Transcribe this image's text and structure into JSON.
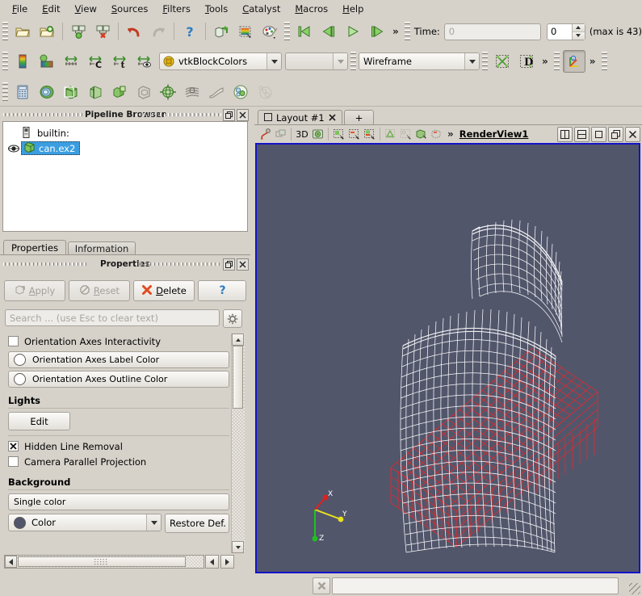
{
  "app": {
    "background_color": "#d6d2ca",
    "render_background_color": "#52566b",
    "accent_blue": "#1414c8"
  },
  "menubar": {
    "items": [
      {
        "label": "File",
        "mnemonic": "F"
      },
      {
        "label": "Edit",
        "mnemonic": "E"
      },
      {
        "label": "View",
        "mnemonic": "V"
      },
      {
        "label": "Sources",
        "mnemonic": "S"
      },
      {
        "label": "Filters",
        "mnemonic": "F"
      },
      {
        "label": "Tools",
        "mnemonic": "T"
      },
      {
        "label": "Catalyst",
        "mnemonic": "C"
      },
      {
        "label": "Macros",
        "mnemonic": "M"
      },
      {
        "label": "Help",
        "mnemonic": "H"
      }
    ]
  },
  "toolbar_main": {
    "buttons": [
      {
        "name": "open-file-icon",
        "tooltip": "Open"
      },
      {
        "name": "recent-files-icon",
        "tooltip": "Recent Files"
      },
      {
        "name": "save-state-icon",
        "tooltip": "Save State"
      },
      {
        "name": "load-state-icon",
        "tooltip": "Load State"
      },
      {
        "name": "undo-icon",
        "tooltip": "Undo"
      },
      {
        "name": "redo-icon",
        "tooltip": "Redo"
      },
      {
        "name": "help-icon",
        "tooltip": "Help"
      },
      {
        "name": "connect-server-icon",
        "tooltip": "Connect"
      },
      {
        "name": "capture-screenshot-icon",
        "tooltip": "Save Screenshot"
      },
      {
        "name": "color-palette-icon",
        "tooltip": "Edit Color Palette"
      }
    ],
    "vcr": [
      {
        "name": "first-frame-icon",
        "tooltip": "First Frame"
      },
      {
        "name": "previous-frame-icon",
        "tooltip": "Previous Frame"
      },
      {
        "name": "play-icon",
        "tooltip": "Play"
      },
      {
        "name": "next-frame-icon",
        "tooltip": "Next Frame"
      }
    ],
    "overflow_label": "»",
    "time_label": "Time:",
    "time_value": "",
    "time_placeholder": "0",
    "frame_value": "0",
    "max_label": "(max is 43)"
  },
  "toolbar_color": {
    "buttons": [
      {
        "name": "color-legend-icon",
        "tooltip": "Toggle Color Legend Visibility"
      },
      {
        "name": "edit-color-map-icon",
        "tooltip": "Edit Color Map"
      },
      {
        "name": "rescale-to-data-range-icon",
        "tooltip": "Rescale to Data Range"
      },
      {
        "name": "rescale-custom-range-icon",
        "tooltip": "Rescale to Custom Data Range"
      },
      {
        "name": "rescale-temporal-range-icon",
        "tooltip": "Rescale to Data Range Over All Timesteps"
      },
      {
        "name": "rescale-visible-range-icon",
        "tooltip": "Rescale to Visible Range"
      }
    ],
    "array_combo_value": "vtkBlockColors",
    "component_combo_value": "",
    "representation_combo_value": "Wireframe",
    "extra_buttons": [
      {
        "name": "show-center-axes-icon",
        "tooltip": "Show Center"
      },
      {
        "name": "data-axes-grid-icon",
        "tooltip": "Data Axes Grid"
      }
    ],
    "overflow_label": "»",
    "pressed_button": {
      "name": "center-axes-visibility-icon",
      "tooltip": "Center Axes Visibility"
    },
    "overflow_label2": "»"
  },
  "toolbar_filters": {
    "buttons": [
      {
        "name": "calculator-filter-icon",
        "tooltip": "Calculator"
      },
      {
        "name": "contour-filter-icon",
        "tooltip": "Contour"
      },
      {
        "name": "clip-filter-icon",
        "tooltip": "Clip"
      },
      {
        "name": "slice-filter-icon",
        "tooltip": "Slice"
      },
      {
        "name": "threshold-filter-icon",
        "tooltip": "Threshold"
      },
      {
        "name": "extract-subset-filter-icon",
        "tooltip": "Extract Subset"
      },
      {
        "name": "glyph-filter-icon",
        "tooltip": "Glyph"
      },
      {
        "name": "stream-tracer-filter-icon",
        "tooltip": "Stream Tracer"
      },
      {
        "name": "warp-filter-icon",
        "tooltip": "Warp By Vector"
      },
      {
        "name": "group-datasets-filter-icon",
        "tooltip": "Group Datasets"
      },
      {
        "name": "extract-level-filter-icon",
        "tooltip": "Extract Level"
      }
    ]
  },
  "pipeline_browser": {
    "title": "Pipeline Browser",
    "float_button": "float-panel-icon",
    "close_button": "close-panel-icon",
    "server": {
      "label": "builtin:",
      "icon": "server-icon"
    },
    "items": [
      {
        "label": "can.ex2",
        "icon": "dataset-icon",
        "selected": true,
        "visible": true,
        "eye_icon": "eye-icon"
      }
    ]
  },
  "properties_panel": {
    "tabs": [
      {
        "label": "Properties",
        "active": true
      },
      {
        "label": "Information",
        "active": false
      }
    ],
    "title": "Properties",
    "float_button": "float-panel-icon",
    "close_button": "close-panel-icon",
    "buttons": [
      {
        "label": "Apply",
        "mnemonic": "A",
        "icon": "apply-icon",
        "enabled": false
      },
      {
        "label": "Reset",
        "mnemonic": "R",
        "icon": "reset-icon",
        "enabled": false
      },
      {
        "label": "Delete",
        "mnemonic": "D",
        "icon": "delete-icon",
        "enabled": true
      },
      {
        "label": "",
        "icon": "help-question-icon",
        "enabled": true
      }
    ],
    "search_placeholder": "Search ... (use Esc to clear text)",
    "search_value": "",
    "gear_button": "gear-icon",
    "rows": [
      {
        "type": "checkbox",
        "label": "Orientation Axes Interactivity",
        "checked": false
      },
      {
        "type": "colorbutton",
        "label": "Orientation Axes Label Color",
        "swatch": "#ffffff"
      },
      {
        "type": "colorbutton",
        "label": "Orientation Axes Outline Color",
        "swatch": "#ffffff"
      },
      {
        "type": "group",
        "label": "Lights"
      },
      {
        "type": "button",
        "label": "Edit"
      },
      {
        "type": "separator"
      },
      {
        "type": "checkbox",
        "label": "Hidden Line Removal",
        "checked": true
      },
      {
        "type": "checkbox",
        "label": "Camera Parallel Projection",
        "checked": false
      },
      {
        "type": "group",
        "label": "Background"
      },
      {
        "type": "combo",
        "label": "Single color"
      },
      {
        "type": "colorcombo",
        "label": "Color",
        "swatch": "#52566b",
        "side_button": "Restore Def."
      }
    ]
  },
  "layout": {
    "tabs": [
      {
        "label": "Layout #1",
        "icon": "layout-icon",
        "close_icon": "close-tab-icon",
        "active": true
      },
      {
        "label": "+",
        "active": false
      }
    ]
  },
  "view_toolbar": {
    "buttons": [
      {
        "name": "interactive-select-icon"
      },
      {
        "name": "interactive-select-points-icon"
      },
      {
        "name": "3d-label",
        "label": "3D"
      },
      {
        "name": "camera-reset-icon"
      },
      {
        "name": "select-cells-icon"
      },
      {
        "name": "select-points-icon"
      },
      {
        "name": "select-cells-through-icon"
      },
      {
        "name": "select-points-through-icon"
      },
      {
        "name": "select-frustum-icon"
      },
      {
        "name": "select-blocks-icon"
      },
      {
        "name": "hover-cells-icon"
      }
    ],
    "overflow_label": "»",
    "view_name": "RenderView1",
    "corner_buttons": [
      {
        "name": "split-horizontal-icon"
      },
      {
        "name": "split-vertical-icon"
      },
      {
        "name": "maximize-view-icon"
      },
      {
        "name": "undock-view-icon"
      },
      {
        "name": "close-view-icon"
      }
    ]
  },
  "render_view": {
    "background_color": "#52566b",
    "border_color": "#1414c8",
    "orientation_axes": {
      "x": {
        "label": "X",
        "color": "#e02020"
      },
      "y": {
        "label": "Y",
        "color": "#e8e020"
      },
      "z": {
        "label": "Z",
        "color": "#20c020"
      }
    },
    "objects": [
      {
        "name": "can-mesh",
        "color": "#ffffff",
        "representation": "Wireframe"
      },
      {
        "name": "brick-mesh",
        "color": "#ff0000",
        "representation": "Wireframe"
      }
    ]
  },
  "statusbar": {
    "stop_button": "abort-icon",
    "progress_value": ""
  }
}
